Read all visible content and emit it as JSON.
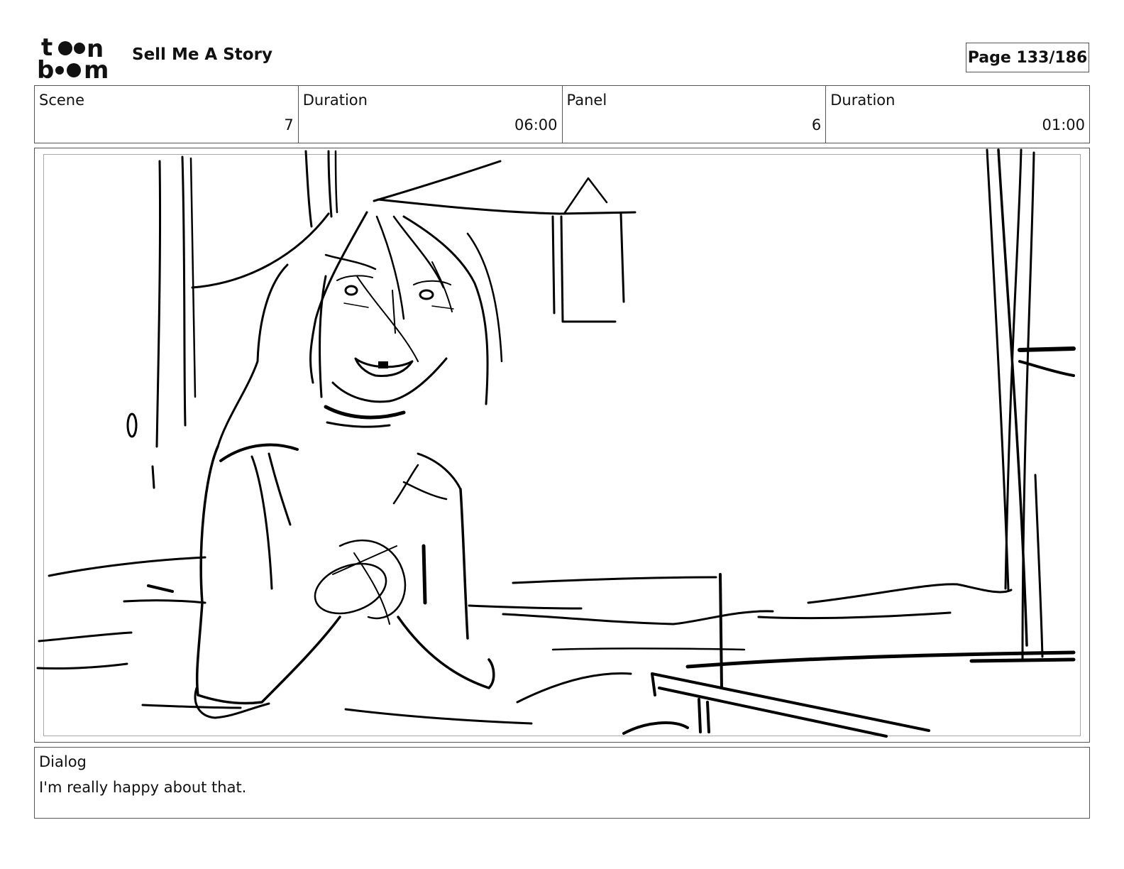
{
  "header": {
    "logo_text": "toonboom",
    "project_title": "Sell Me A Story",
    "page_label": "Page 133/186"
  },
  "info": [
    {
      "label": "Scene",
      "value": "7"
    },
    {
      "label": "Duration",
      "value": "06:00"
    },
    {
      "label": "Panel",
      "value": "6"
    },
    {
      "label": "Duration",
      "value": "01:00"
    }
  ],
  "panel": {
    "image": "storyboard-sketch"
  },
  "dialog": {
    "label": "Dialog",
    "text": "I'm really happy about that."
  }
}
